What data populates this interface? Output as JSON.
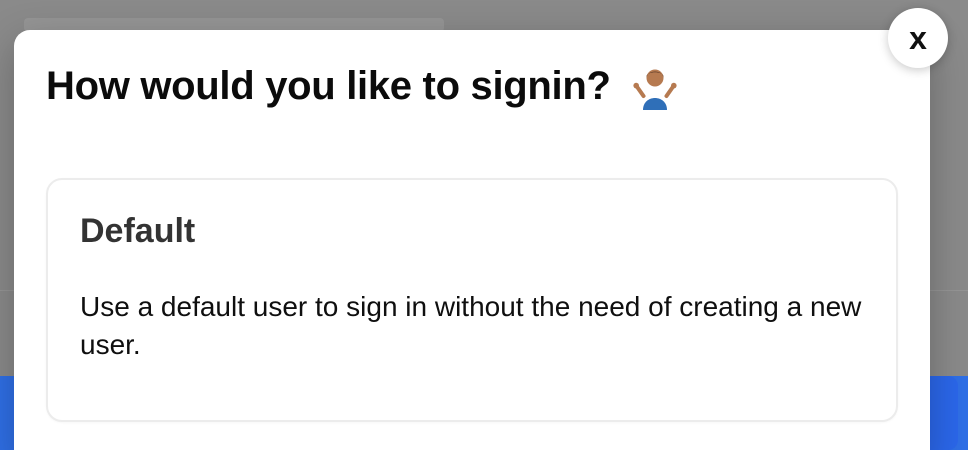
{
  "modal": {
    "title": "How would you like to signin?",
    "title_icon": "person-shrugging-icon",
    "close_label": "x"
  },
  "option": {
    "title": "Default",
    "description": "Use a default user to sign in without the need of creating a new user."
  },
  "colors": {
    "modal_bg": "#ffffff",
    "card_border": "#ececec",
    "backdrop": "#8a8a8a",
    "primary_band": "#2f6fe6"
  }
}
